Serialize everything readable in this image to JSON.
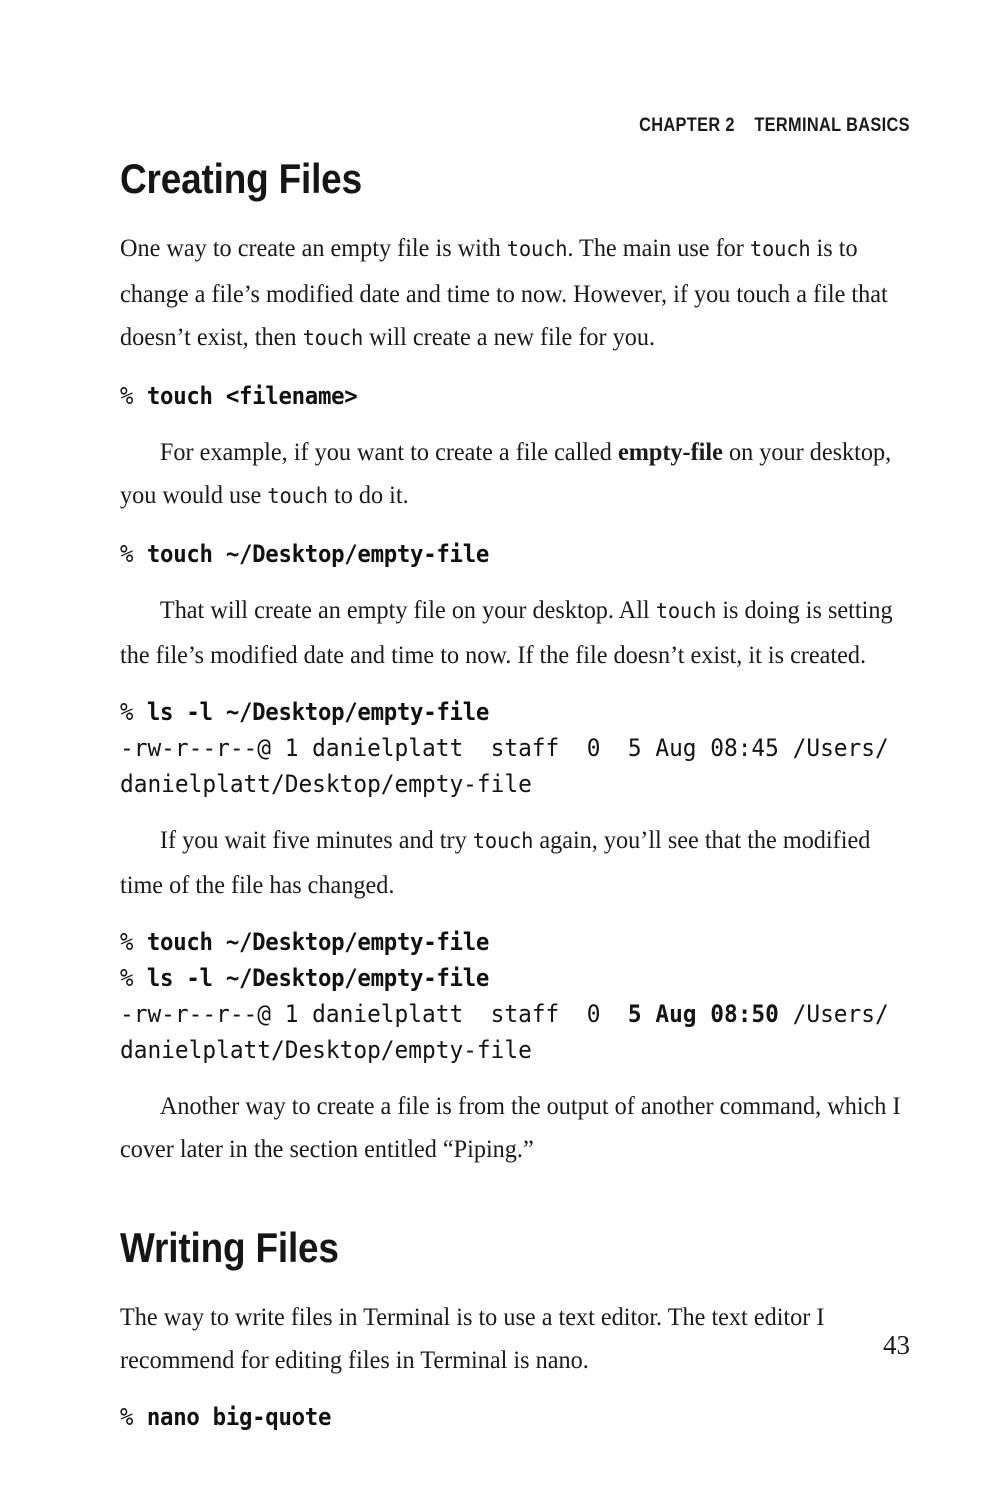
{
  "header": {
    "running_head": "CHAPTER 2    TERMINAL BASICS"
  },
  "folio": "43",
  "sections": [
    {
      "title": "Creating Files",
      "blocks": [
        {
          "kind": "paragraph",
          "indent": false,
          "runs": [
            {
              "t": "One way to create an empty file is with ",
              "style": "normal"
            },
            {
              "t": "touch",
              "style": "mono"
            },
            {
              "t": ". The main use for ",
              "style": "normal"
            },
            {
              "t": "touch",
              "style": "mono"
            },
            {
              "t": " is to change a file’s modified date and time to now. However, if you touch a file that doesn’t exist, then ",
              "style": "normal"
            },
            {
              "t": "touch",
              "style": "mono"
            },
            {
              "t": " will create a new file for you.",
              "style": "normal"
            }
          ]
        },
        {
          "kind": "command",
          "prompt": "% ",
          "command": "touch <filename>"
        },
        {
          "kind": "paragraph",
          "indent": true,
          "runs": [
            {
              "t": "For example, if you want to create a file called ",
              "style": "normal"
            },
            {
              "t": "empty-file",
              "style": "bold"
            },
            {
              "t": " on your desktop, you would use ",
              "style": "normal"
            },
            {
              "t": "touch",
              "style": "mono"
            },
            {
              "t": " to do it.",
              "style": "normal"
            }
          ]
        },
        {
          "kind": "command",
          "prompt": "% ",
          "command": "touch ~/Desktop/empty-file"
        },
        {
          "kind": "paragraph",
          "indent": true,
          "runs": [
            {
              "t": "That will create an empty file on your desktop. All ",
              "style": "normal"
            },
            {
              "t": "touch",
              "style": "mono"
            },
            {
              "t": " is doing is setting the file’s modified date and time to now. If the file doesn’t exist, it is created.",
              "style": "normal"
            }
          ]
        },
        {
          "kind": "command",
          "prompt": "% ",
          "command": "ls -l ~/Desktop/empty-file"
        },
        {
          "kind": "output",
          "runs": [
            {
              "t": "-rw-r--r--@ 1 danielplatt  staff  0  5 Aug 08:45 /Users/",
              "style": "normal"
            },
            {
              "t": "\n",
              "style": "normal"
            },
            {
              "t": "danielplatt/Desktop/empty-file",
              "style": "normal"
            }
          ]
        },
        {
          "kind": "paragraph",
          "indent": true,
          "runs": [
            {
              "t": "If you wait five minutes and try ",
              "style": "normal"
            },
            {
              "t": "touch",
              "style": "mono"
            },
            {
              "t": " again, you’ll see that the modified time of the file has changed.",
              "style": "normal"
            }
          ]
        },
        {
          "kind": "command",
          "prompt": "% ",
          "command": "touch ~/Desktop/empty-file"
        },
        {
          "kind": "command",
          "prompt": "% ",
          "command": "ls -l ~/Desktop/empty-file"
        },
        {
          "kind": "output",
          "runs": [
            {
              "t": "-rw-r--r--@ 1 danielplatt  staff  0  ",
              "style": "normal"
            },
            {
              "t": "5 Aug 08:50",
              "style": "bold"
            },
            {
              "t": " /Users/",
              "style": "normal"
            },
            {
              "t": "\n",
              "style": "normal"
            },
            {
              "t": "danielplatt/Desktop/empty-file",
              "style": "normal"
            }
          ]
        },
        {
          "kind": "paragraph",
          "indent": true,
          "runs": [
            {
              "t": "Another way to create a file is from the output of another command, which I cover later in the section entitled “Piping.”",
              "style": "normal"
            }
          ]
        }
      ]
    },
    {
      "title": "Writing Files",
      "blocks": [
        {
          "kind": "paragraph",
          "indent": false,
          "runs": [
            {
              "t": "The way to write files in Terminal is to use a text editor. The text editor I recommend for editing files in Terminal is nano.",
              "style": "normal"
            }
          ]
        },
        {
          "kind": "command",
          "prompt": "% ",
          "command": "nano big-quote"
        }
      ]
    }
  ]
}
